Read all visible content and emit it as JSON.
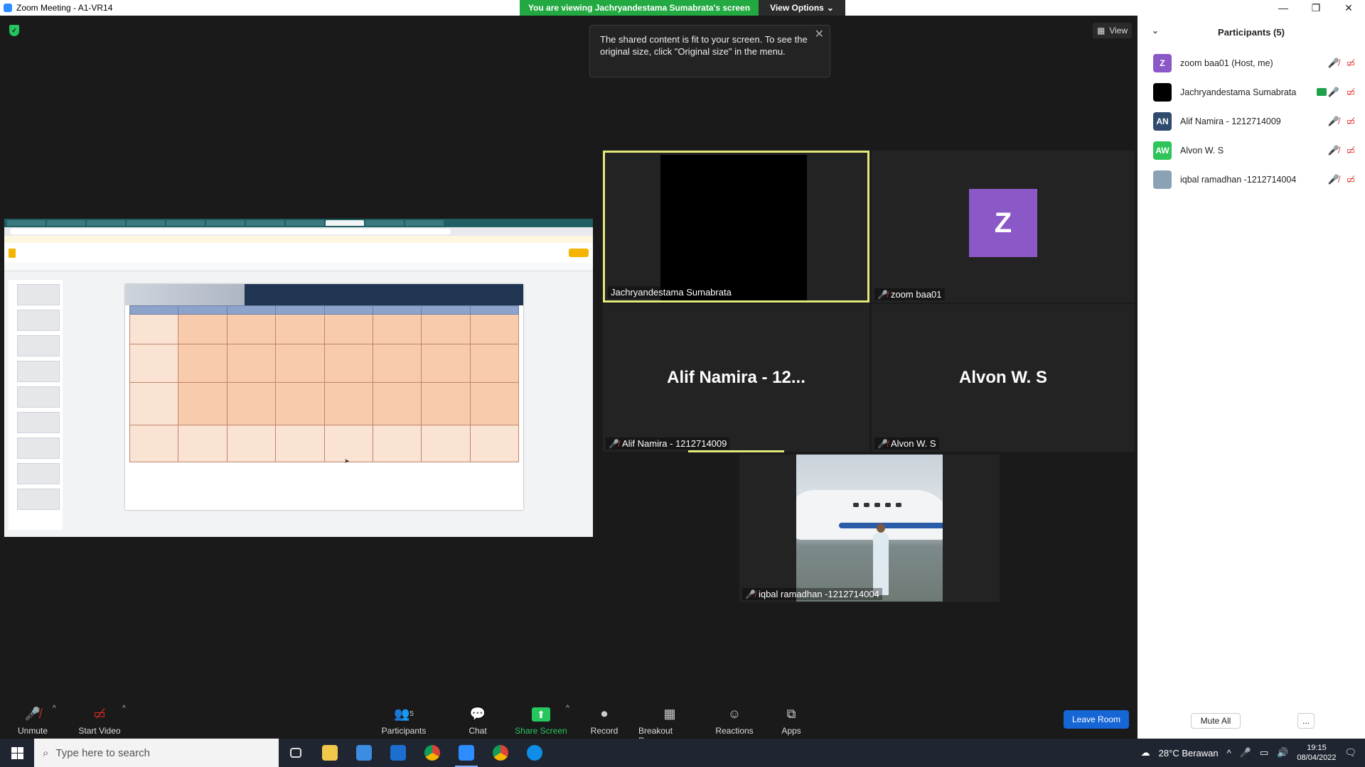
{
  "window": {
    "title": "Zoom Meeting - A1-VR14",
    "minimize": "—",
    "restore": "❐",
    "close": "✕"
  },
  "banner": {
    "viewing_text": "You are viewing Jachryandestama Sumabrata's screen",
    "view_options": "View Options"
  },
  "tooltip": {
    "text": "The shared content is fit to your screen. To see the original size, click \"Original size\" in the menu."
  },
  "view_button": {
    "label": "View",
    "icon": "grid-icon"
  },
  "tiles": [
    {
      "name": "Jachryandestama Sumabrata",
      "muted": false,
      "active": true
    },
    {
      "name": "zoom baa01",
      "avatar_letter": "Z",
      "muted": true
    },
    {
      "name": "Alif Namira - 1212714009",
      "display": "Alif Namira - 12...",
      "muted": true
    },
    {
      "name": "Alvon W. S",
      "display": "Alvon W. S",
      "muted": true
    },
    {
      "name": "iqbal ramadhan -1212714004",
      "muted": true
    }
  ],
  "participants_panel": {
    "title": "Participants (5)",
    "items": [
      {
        "avatar": "Z",
        "color": "#8b58c7",
        "name": "zoom baa01 (Host, me)"
      },
      {
        "avatar": "",
        "color": "#000000",
        "name": "Jachryandestama Sumabrata",
        "sharing": true
      },
      {
        "avatar": "AN",
        "color": "#2f4a6d",
        "name": "Alif Namira - 1212714009"
      },
      {
        "avatar": "AW",
        "color": "#2ec45a",
        "name": "Alvon W. S"
      },
      {
        "avatar": "",
        "color": "#8aa2b3",
        "name": "iqbal ramadhan -1212714004"
      }
    ],
    "mute_all": "Mute All",
    "more": "..."
  },
  "toolbar": {
    "unmute": "Unmute",
    "start_video": "Start Video",
    "participants": "Participants",
    "participants_count": "5",
    "chat": "Chat",
    "share_screen": "Share Screen",
    "record": "Record",
    "breakout_rooms": "Breakout Rooms",
    "reactions": "Reactions",
    "apps": "Apps",
    "leave": "Leave Room"
  },
  "taskbar": {
    "search_placeholder": "Type here to search",
    "weather": "28°C  Berawan",
    "time": "19:15",
    "date": "08/04/2022"
  }
}
